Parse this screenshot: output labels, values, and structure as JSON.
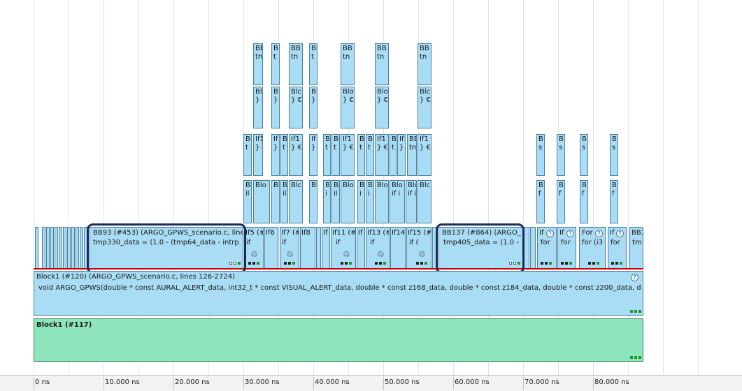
{
  "timeline": {
    "ticks": [
      "0 ns",
      "10.000 ns",
      "20.000 ns",
      "30.000 ns",
      "40.000 ns",
      "50.000 ns",
      "60.000 ns",
      "70.000 ns",
      "80.000 ns"
    ]
  },
  "stack": {
    "row1": [
      "BB",
      "B",
      "BB",
      "Bl",
      "BB",
      "BB",
      "BB"
    ],
    "row1b": [
      "tn",
      "t",
      "tn",
      "t",
      "tn",
      "tn",
      "tn"
    ],
    "row2": [
      "Blo",
      "B",
      "Blc",
      "Bl",
      "Blo",
      "Blo",
      "Blc"
    ],
    "row2b": [
      "} €",
      "}",
      "} €",
      "}",
      "} €",
      "} €",
      "} €"
    ],
    "row3": [
      "Bl",
      "If1",
      "If",
      "Bl",
      "If1",
      "If",
      "B",
      "Bl",
      "If1",
      "B",
      "Bl",
      "If1",
      "B",
      "If1",
      "BB",
      "BB",
      "If1"
    ],
    "row3b": [
      "t",
      "} €",
      "}",
      "t",
      "} €",
      "}",
      "t",
      "t",
      "} €",
      "t",
      "t",
      "} €",
      "t",
      "} €",
      "tn",
      "tn",
      "} €"
    ],
    "row4": [
      "Bl",
      "Blo",
      "Bl",
      "Bl",
      "Blc",
      "Bl",
      "B",
      "Bl",
      "Blo",
      "B",
      "Bl",
      "Blo",
      "Blo",
      "Blo",
      "Blc"
    ],
    "row4b": [
      "il",
      "il",
      "i",
      "il",
      "i",
      "i",
      "if i",
      "if i"
    ],
    "right_b": [
      "B",
      "B",
      "B",
      "B"
    ],
    "right_s": [
      "s",
      "s",
      "s",
      "s"
    ],
    "right_f": [
      "f",
      "f",
      "f",
      "f"
    ]
  },
  "basic_blocks": {
    "bb93_title": "BB93 (#453)  (ARGO_GPWS_scenario.c, line",
    "bb93_code": "tmp330_data = (1.0 - (tmp64_data - intrp",
    "if5": "If5 (#4",
    "if5_body": "if",
    "if6": "If6",
    "if7": "If7 (#",
    "if7_body": "if",
    "if8": "If8",
    "if_small": "If",
    "if11": "If11 (#",
    "if11_body": "if",
    "if_b": "If",
    "if13": "If13 (#",
    "if13_body": "if",
    "if14": "If14",
    "if15": "If15 (#",
    "if15_body": "if (",
    "bb137_title": "BB137 (#864)  (ARGO_",
    "bb137_code": "tmp405_data = (1.0 -",
    "for1_title": "If",
    "for1_body": "for",
    "for2_title": "If",
    "for2_body": "for",
    "for3_title": "For",
    "for3_body": "for (i3",
    "for4_title": "If",
    "for4_body": "for",
    "bb_last_title": "BB3",
    "bb_last_body": "tm"
  },
  "function_block": {
    "title": "Block1 (#120)  (ARGO_GPWS_scenario.c, lines 126-2724)",
    "signature": "void ARGO_GPWS(double * const AURAL_ALERT_data, int32_t * const VISUAL_ALERT_data, double * const z168_data, double * const z184_data, double * const z200_data, d"
  },
  "outer_block": {
    "title": "Block1 (#117)"
  },
  "icons": {
    "loop": "loop-icon",
    "help": "help-icon"
  },
  "colors": {
    "block_blue": "#a9dcf5",
    "block_green": "#8ee4bc",
    "highlight": "#1a2a5a",
    "red_line": "#d40000"
  }
}
